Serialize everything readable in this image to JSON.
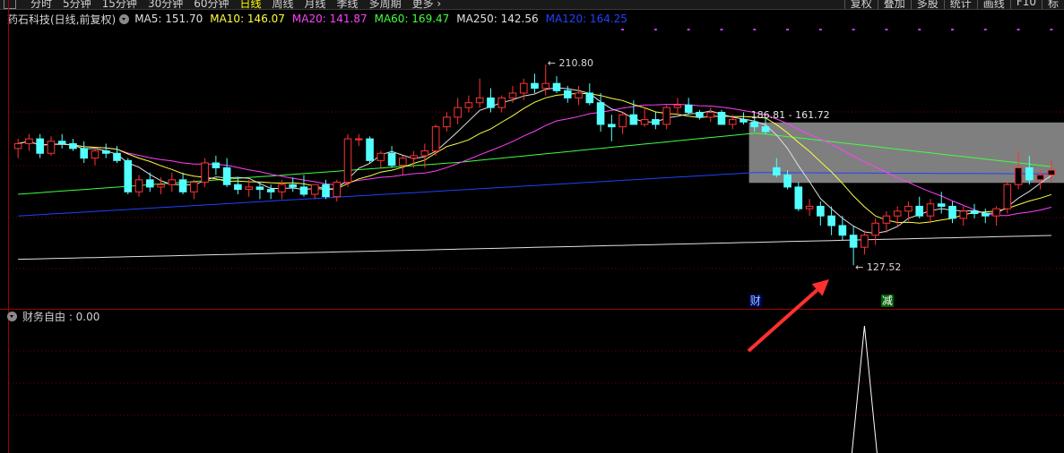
{
  "toolbar": {
    "periods": [
      "分时",
      "5分钟",
      "15分钟",
      "30分钟",
      "60分钟",
      "日线",
      "周线",
      "月线",
      "季线",
      "多周期",
      "更多 ›"
    ],
    "active_period": "日线",
    "tools": [
      "复权",
      "叠加",
      "多股",
      "统计",
      "画线",
      "F10",
      "标"
    ]
  },
  "header": {
    "stock_title": "药石科技(日线,前复权)",
    "ma": [
      {
        "name": "MA5",
        "value": "151.70",
        "color": "#e0e0e0"
      },
      {
        "name": "MA10",
        "value": "146.07",
        "color": "#ffff40"
      },
      {
        "name": "MA20",
        "value": "141.87",
        "color": "#ff40ff"
      },
      {
        "name": "MA60",
        "value": "169.47",
        "color": "#40ff40"
      },
      {
        "name": "MA250",
        "value": "142.56",
        "color": "#e0e0e0"
      },
      {
        "name": "MA120",
        "value": "164.25",
        "color": "#2040ff"
      }
    ]
  },
  "chart_data": {
    "type": "candlestick",
    "high_label": "210.80",
    "low_label": "127.52",
    "box_label": "186.81 - 161.72",
    "markers": [
      "财",
      "减"
    ],
    "ylim": [
      115,
      225
    ],
    "colors": {
      "up": "#ff3333",
      "down": "#54ffff",
      "ma5": "#e0e0e0",
      "ma10": "#ffff40",
      "ma20": "#ff40ff",
      "ma60": "#40ff40",
      "ma120": "#2040ff",
      "ma250": "#e0e0e0",
      "box": "#7f7f7f"
    },
    "candles": [
      [
        176,
        180,
        172,
        178
      ],
      [
        178,
        182,
        175,
        180
      ],
      [
        180,
        182,
        172,
        174
      ],
      [
        174,
        181,
        173,
        179
      ],
      [
        179,
        182,
        176,
        178
      ],
      [
        178,
        180,
        175,
        176
      ],
      [
        176,
        179,
        170,
        172
      ],
      [
        172,
        176,
        169,
        175
      ],
      [
        175,
        178,
        172,
        174
      ],
      [
        174,
        177,
        170,
        171
      ],
      [
        171,
        172,
        157,
        158
      ],
      [
        158,
        165,
        156,
        163
      ],
      [
        163,
        166,
        158,
        160
      ],
      [
        160,
        164,
        157,
        161
      ],
      [
        161,
        166,
        158,
        163
      ],
      [
        163,
        166,
        157,
        158
      ],
      [
        158,
        163,
        155,
        162
      ],
      [
        162,
        172,
        160,
        170
      ],
      [
        170,
        173,
        165,
        168
      ],
      [
        168,
        172,
        160,
        161
      ],
      [
        161,
        164,
        157,
        159
      ],
      [
        159,
        163,
        156,
        160
      ],
      [
        160,
        162,
        155,
        159
      ],
      [
        159,
        161,
        155,
        158
      ],
      [
        158,
        163,
        155,
        161
      ],
      [
        161,
        164,
        158,
        160
      ],
      [
        160,
        165,
        156,
        157
      ],
      [
        157,
        161,
        155,
        161
      ],
      [
        161,
        163,
        155,
        156
      ],
      [
        156,
        163,
        154,
        162
      ],
      [
        162,
        182,
        160,
        180
      ],
      [
        180,
        182,
        177,
        180
      ],
      [
        180,
        181,
        170,
        171
      ],
      [
        171,
        175,
        168,
        174
      ],
      [
        174,
        177,
        168,
        169
      ],
      [
        169,
        173,
        165,
        172
      ],
      [
        172,
        175,
        168,
        173
      ],
      [
        173,
        178,
        168,
        175
      ],
      [
        175,
        186,
        173,
        185
      ],
      [
        185,
        191,
        183,
        189
      ],
      [
        189,
        197,
        186,
        193
      ],
      [
        193,
        198,
        191,
        195
      ],
      [
        195,
        205,
        193,
        197
      ],
      [
        197,
        201,
        191,
        193
      ],
      [
        193,
        198,
        191,
        197
      ],
      [
        197,
        202,
        195,
        199
      ],
      [
        199,
        205,
        196,
        203
      ],
      [
        203,
        207,
        199,
        201
      ],
      [
        201,
        210.8,
        198,
        203
      ],
      [
        203,
        206,
        199,
        200
      ],
      [
        200,
        202,
        195,
        197
      ],
      [
        197,
        202,
        194,
        199
      ],
      [
        199,
        203,
        194,
        195
      ],
      [
        195,
        199,
        183,
        186
      ],
      [
        186,
        190,
        179,
        185
      ],
      [
        185,
        191,
        182,
        190
      ],
      [
        190,
        196,
        187,
        186
      ],
      [
        186,
        193,
        185,
        188
      ],
      [
        188,
        191,
        184,
        186
      ],
      [
        186,
        194,
        184,
        193
      ],
      [
        193,
        197,
        190,
        194
      ],
      [
        194,
        197,
        190,
        191
      ],
      [
        191,
        192,
        188,
        189
      ],
      [
        189,
        193,
        187,
        191
      ],
      [
        191,
        192,
        187,
        186
      ],
      [
        186,
        190,
        184,
        188
      ],
      [
        188,
        191,
        186,
        187
      ],
      [
        187,
        189,
        183,
        185
      ],
      [
        185,
        189,
        182,
        183
      ],
      [
        168,
        172,
        164,
        165
      ],
      [
        165,
        167,
        159,
        160
      ],
      [
        160,
        162,
        150,
        151
      ],
      [
        151,
        155,
        148,
        152
      ],
      [
        152,
        154,
        144,
        148
      ],
      [
        148,
        152,
        140,
        144
      ],
      [
        144,
        148,
        138,
        140
      ],
      [
        140,
        144,
        127.52,
        135
      ],
      [
        135,
        142,
        132,
        140
      ],
      [
        140,
        147,
        136,
        145
      ],
      [
        145,
        150,
        141,
        148
      ],
      [
        148,
        152,
        144,
        150
      ],
      [
        150,
        154,
        146,
        152
      ],
      [
        152,
        156,
        147,
        148
      ],
      [
        148,
        155,
        145,
        153
      ],
      [
        153,
        158,
        149,
        152
      ],
      [
        152,
        154,
        145,
        147
      ],
      [
        147,
        152,
        144,
        150
      ],
      [
        150,
        153,
        147,
        149
      ],
      [
        149,
        151,
        145,
        148
      ],
      [
        148,
        152,
        144,
        151
      ],
      [
        151,
        162,
        149,
        161
      ],
      [
        161,
        175,
        159,
        168
      ],
      [
        168,
        173,
        161,
        163
      ],
      [
        163,
        167,
        159,
        165
      ],
      [
        165,
        171,
        162,
        167
      ]
    ],
    "ma250": [
      [
        0,
        130
      ],
      [
        95,
        140
      ],
      [
        110,
        142.6
      ]
    ]
  },
  "sub_indicator": {
    "name": "财务自由",
    "value": "0.00",
    "label": "财务自由 : 0.00"
  },
  "annotation": {
    "type": "arrow",
    "color": "#ff3030"
  }
}
